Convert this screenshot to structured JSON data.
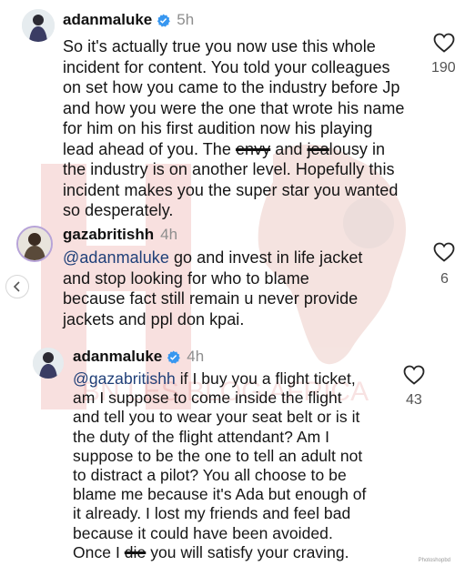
{
  "watermark": {
    "brand_text": "BN LES BLOG AFRICA",
    "logo_letter": "H"
  },
  "comments": [
    {
      "username": "adanmaluke",
      "verified": true,
      "time": "5h",
      "like_count": "190",
      "lines": [
        "So it's actually true you now use this whole",
        "incident for content. You told your  colleagues",
        "on set how you came to the industry before Jp",
        "and how you were the one that wrote his name",
        "for him on his first audition now his playing",
        "lead ahead of you. The ",
        "envy",
        " and ",
        "jea",
        "lousy in",
        "the industry is on another level. Hopefully this",
        "incident makes you the super star you wanted",
        "so desperately."
      ]
    },
    {
      "username": "gazabritishh",
      "verified": false,
      "time": "4h",
      "like_count": "6",
      "mention": "@adanmaluke",
      "lines": [
        " go and invest in life jacket",
        "and stop looking for who to blame",
        "because fact still remain u never provide",
        "jackets and ppl don kpai."
      ]
    },
    {
      "username": "adanmaluke",
      "verified": true,
      "time": "4h",
      "like_count": "43",
      "mention": "@gazabritishh",
      "lines": [
        " if I buy you a flight ticket,",
        "am I suppose to come inside the flight",
        "and tell you to wear your seat belt or is it",
        "the duty of the flight attendant? Am I",
        "suppose to be the one to tell an adult not",
        "to distract a pilot? You all choose to be",
        "blame me because it's Ada but enough of",
        "it already. I lost my friends and feel bad",
        "because it could have been avoided.",
        "Once I ",
        "die",
        " you will satisfy your craving."
      ]
    }
  ],
  "footer_stamp": "Photoshopbd"
}
